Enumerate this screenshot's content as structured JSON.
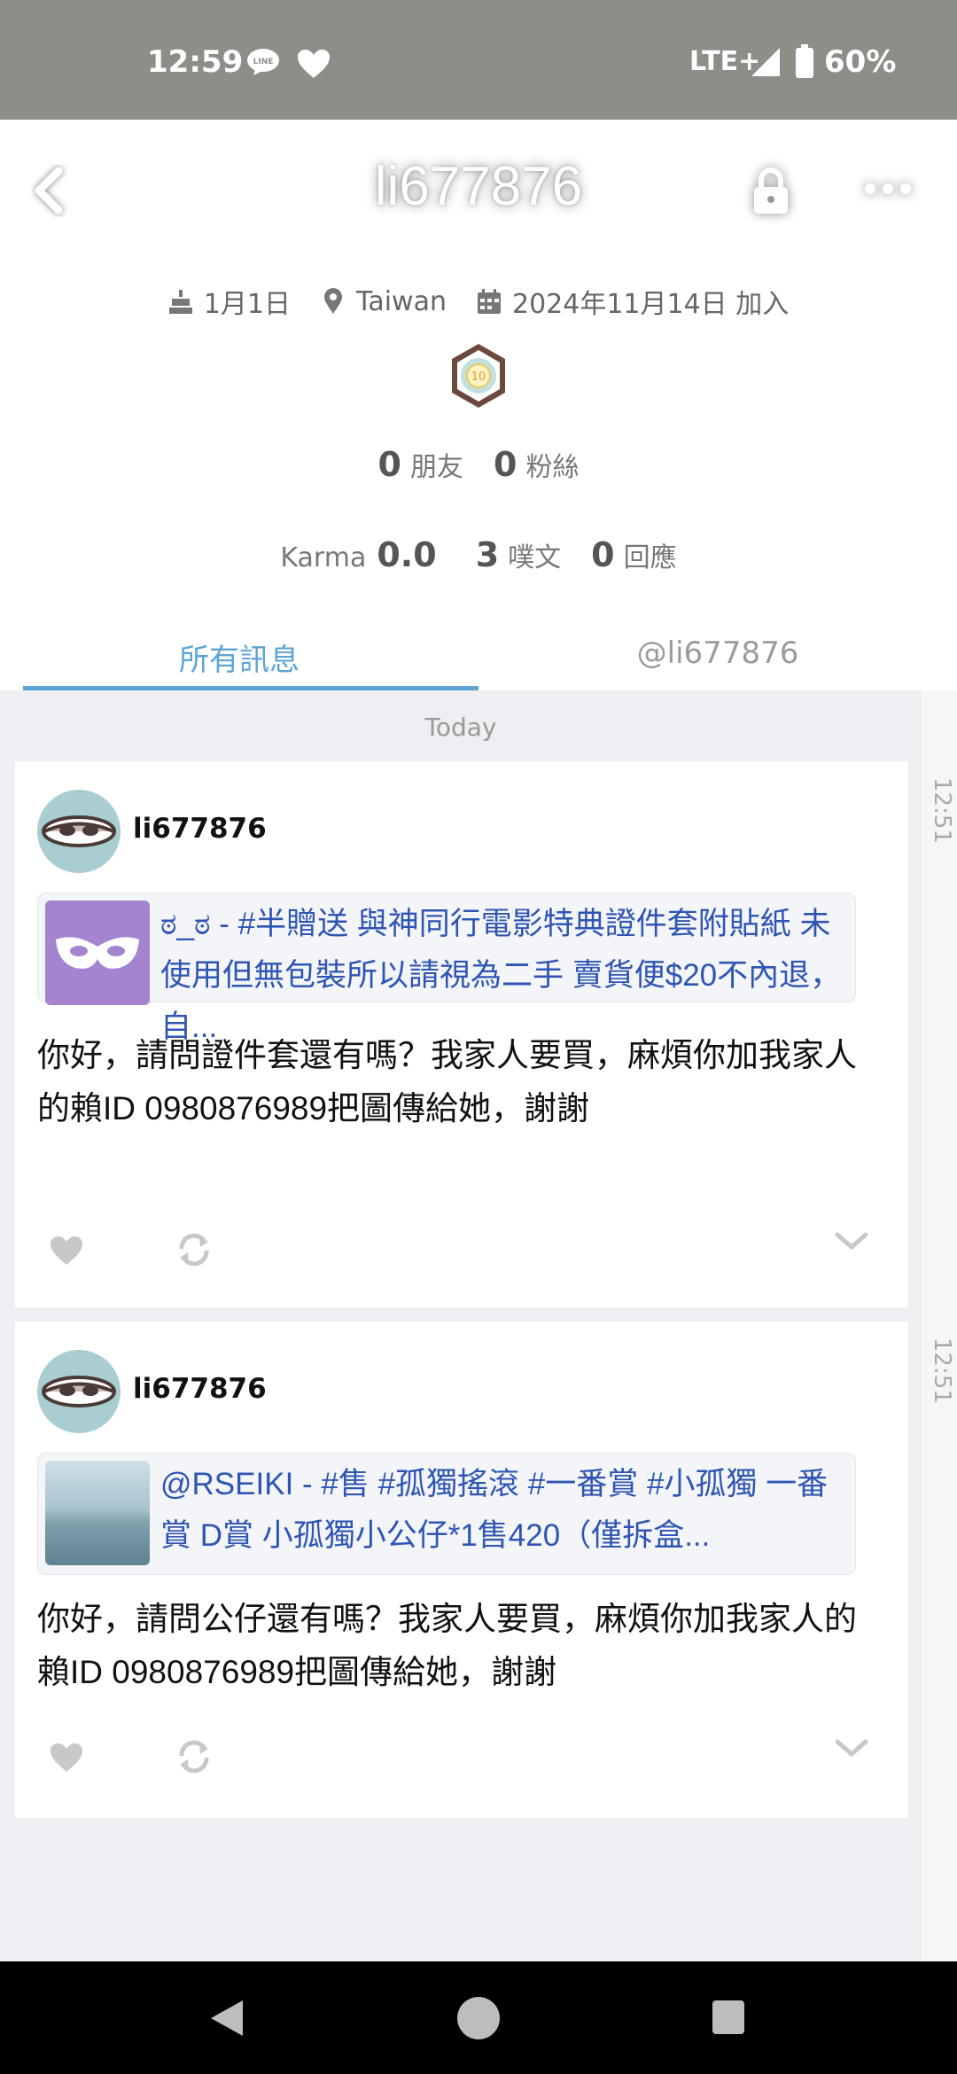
{
  "status_bar": {
    "time": "12:59",
    "network": "LTE+",
    "battery": "60%"
  },
  "header": {
    "title": "li677876"
  },
  "profile": {
    "birthday": "1月1日",
    "location": "Taiwan",
    "joined": "2024年11月14日 加入",
    "badge_level": "10",
    "friends_count": "0",
    "friends_label": "朋友",
    "fans_count": "0",
    "fans_label": "粉絲",
    "karma_label": "Karma",
    "karma_value": "0.0",
    "plurks_count": "3",
    "plurks_label": "噗文",
    "responses_count": "0",
    "responses_label": "回應"
  },
  "tabs": [
    {
      "label": "所有訊息",
      "active": true
    },
    {
      "label": "@li677876",
      "active": false
    }
  ],
  "feed": {
    "date_label": "Today",
    "posts": [
      {
        "time": "12:51",
        "author": "li677876",
        "quote": "ಠ_ಠ - #半贈送 與神同行電影特典證件套附貼紙 未使用但無包裝所以請視為二手 賣貨便$20不內退，自...",
        "body": "你好，請問證件套還有嗎？我家人要買，麻煩你加我家人的賴ID 0980876989把圖傳給她，謝謝"
      },
      {
        "time": "12:51",
        "author": "li677876",
        "quote": "@RSEIKI - #售 #孤獨搖滾 #一番賞 #小孤獨 一番賞 D賞 小孤獨小公仔*1售420（僅拆盒...",
        "body": "你好，請問公仔還有嗎？我家人要買，麻煩你加我家人的賴ID 0980876989把圖傳給她，謝謝"
      }
    ]
  },
  "colors": {
    "accent": "#5ea4d6",
    "link": "#2f55b4",
    "status_bar": "#8f8d88"
  }
}
